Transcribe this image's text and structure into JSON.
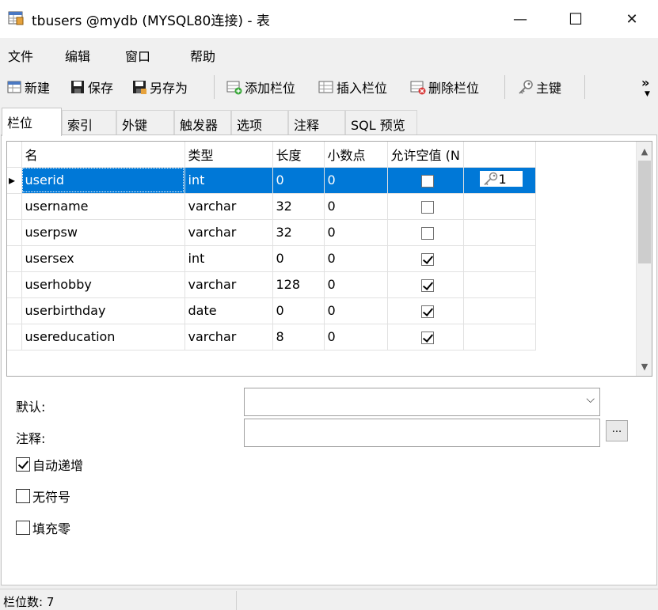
{
  "window": {
    "title": "tbusers @mydb (MYSQL80连接) - 表",
    "minimize": "—",
    "maximize": "☐",
    "close": "✕"
  },
  "menu": {
    "file": "文件",
    "edit": "编辑",
    "window": "窗口",
    "help": "帮助"
  },
  "toolbar": {
    "new": "新建",
    "save": "保存",
    "save_as": "另存为",
    "add_field": "添加栏位",
    "insert_field": "插入栏位",
    "delete_field": "删除栏位",
    "primary_key": "主键",
    "more": "»"
  },
  "tabs": [
    "栏位",
    "索引",
    "外键",
    "触发器",
    "选项",
    "注释",
    "SQL 预览"
  ],
  "grid": {
    "headers": [
      "名",
      "类型",
      "长度",
      "小数点",
      "允许空值 (N"
    ],
    "rows": [
      {
        "name": "userid",
        "type": "int",
        "length": "0",
        "decimals": "0",
        "nullable": false,
        "key": "1"
      },
      {
        "name": "username",
        "type": "varchar",
        "length": "32",
        "decimals": "0",
        "nullable": false
      },
      {
        "name": "userpsw",
        "type": "varchar",
        "length": "32",
        "decimals": "0",
        "nullable": false
      },
      {
        "name": "usersex",
        "type": "int",
        "length": "0",
        "decimals": "0",
        "nullable": true
      },
      {
        "name": "userhobby",
        "type": "varchar",
        "length": "128",
        "decimals": "0",
        "nullable": true
      },
      {
        "name": "userbirthday",
        "type": "date",
        "length": "0",
        "decimals": "0",
        "nullable": true
      },
      {
        "name": "usereducation",
        "type": "varchar",
        "length": "8",
        "decimals": "0",
        "nullable": true
      }
    ]
  },
  "props": {
    "default_label": "默认:",
    "comment_label": "注释:",
    "comment_button": "...",
    "auto_increment": {
      "label": "自动递增",
      "checked": true
    },
    "unsigned": {
      "label": "无符号",
      "checked": false
    },
    "zerofill": {
      "label": "填充零",
      "checked": false
    }
  },
  "status": {
    "field_count": "栏位数: 7"
  },
  "colors": {
    "selection": "#0078d7",
    "background": "#f0f0f0"
  }
}
